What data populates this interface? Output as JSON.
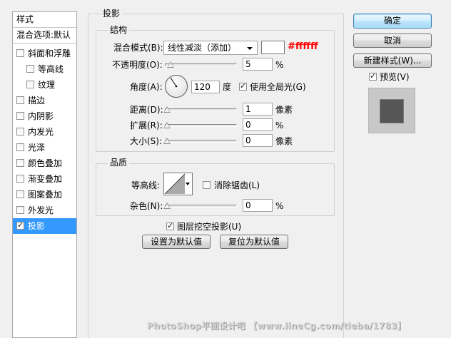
{
  "sidebar": {
    "header": "样式",
    "blend_options": "混合选项:默认",
    "items": [
      {
        "label": "斜面和浮雕",
        "checked": false
      },
      {
        "label": "等高线",
        "checked": false
      },
      {
        "label": "纹理",
        "checked": false
      },
      {
        "label": "描边",
        "checked": false
      },
      {
        "label": "内阴影",
        "checked": false
      },
      {
        "label": "内发光",
        "checked": false
      },
      {
        "label": "光泽",
        "checked": false
      },
      {
        "label": "颜色叠加",
        "checked": false
      },
      {
        "label": "渐变叠加",
        "checked": false
      },
      {
        "label": "图案叠加",
        "checked": false
      },
      {
        "label": "外发光",
        "checked": false
      },
      {
        "label": "投影",
        "checked": true
      }
    ]
  },
  "shadow": {
    "title": "投影",
    "structure": {
      "title": "结构",
      "blend_mode_label": "混合模式(B):",
      "blend_mode_value": "线性减淡（添加）",
      "color_hex_label": "#ffffff",
      "swatch_color": "#ffffff",
      "opacity_label": "不透明度(O):",
      "opacity_value": "5",
      "opacity_unit": "%",
      "angle_label": "角度(A):",
      "angle_value": "120",
      "angle_unit": "度",
      "global_light_label": "使用全局光(G)",
      "global_light_checked": true,
      "distance_label": "距离(D):",
      "distance_value": "1",
      "distance_unit": "像素",
      "spread_label": "扩展(R):",
      "spread_value": "0",
      "spread_unit": "%",
      "size_label": "大小(S):",
      "size_value": "0",
      "size_unit": "像素"
    },
    "quality": {
      "title": "品质",
      "contour_label": "等高线:",
      "anti_alias_label": "消除锯齿(L)",
      "anti_alias_checked": false,
      "noise_label": "杂色(N):",
      "noise_value": "0",
      "noise_unit": "%"
    },
    "knockout_label": "图层挖空投影(U)",
    "knockout_checked": true,
    "make_default": "设置为默认值",
    "reset_default": "复位为默认值"
  },
  "actions": {
    "ok": "确定",
    "cancel": "取消",
    "new_style": "新建样式(W)...",
    "preview_label": "预览(V)",
    "preview_checked": true
  },
  "watermark": "PhotoShop平面设计吧 【www.lineCg.com/tieba/1783】",
  "accent_color": "#3399ff",
  "hex_text_color": "#ff0000"
}
